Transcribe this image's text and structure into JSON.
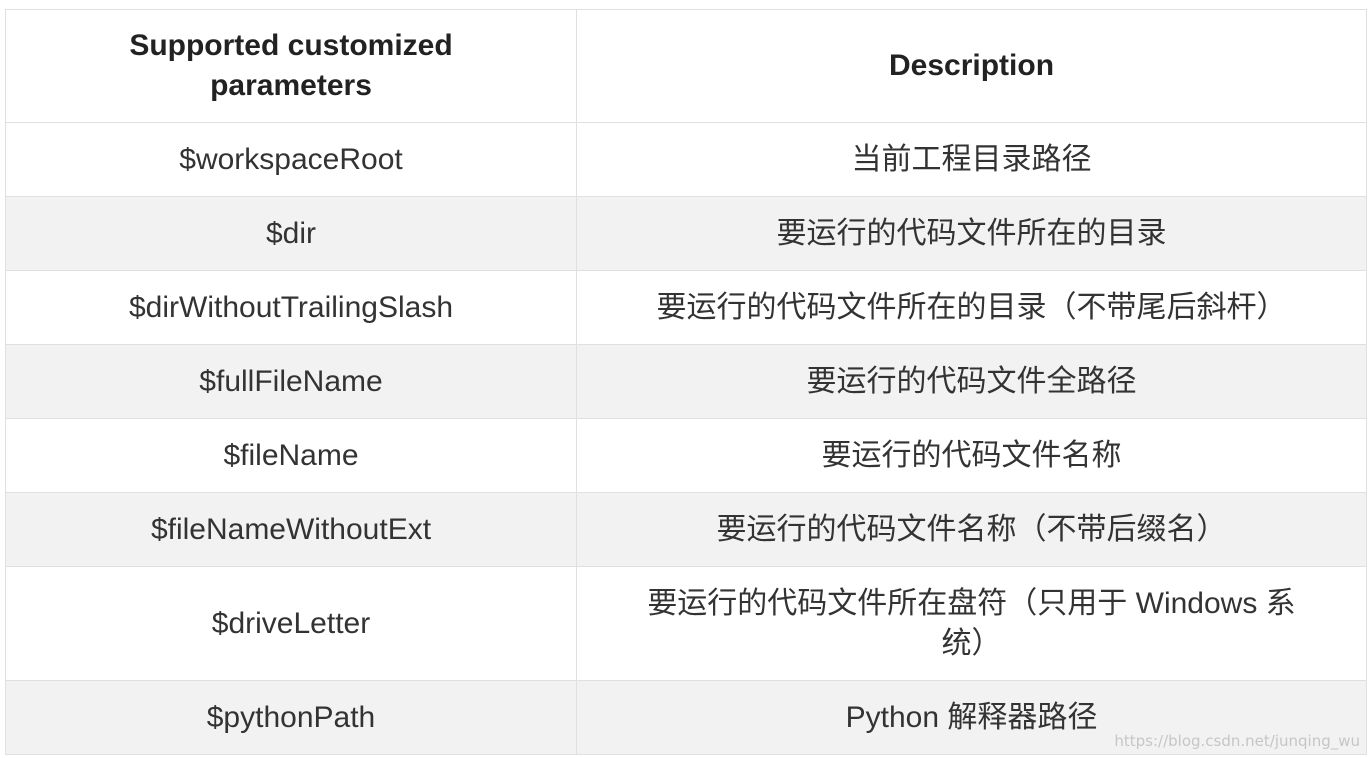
{
  "table": {
    "headers": [
      "Supported customized parameters",
      "Description"
    ],
    "rows": [
      {
        "param": "$workspaceRoot",
        "description": "当前工程目录路径"
      },
      {
        "param": "$dir",
        "description": "要运行的代码文件所在的目录"
      },
      {
        "param": "$dirWithoutTrailingSlash",
        "description": "要运行的代码文件所在的目录（不带尾后斜杆）"
      },
      {
        "param": "$fullFileName",
        "description": "要运行的代码文件全路径"
      },
      {
        "param": "$fileName",
        "description": "要运行的代码文件名称"
      },
      {
        "param": "$fileNameWithoutExt",
        "description": "要运行的代码文件名称（不带后缀名）"
      },
      {
        "param": "$driveLetter",
        "description": "要运行的代码文件所在盘符（只用于 Windows 系统）"
      },
      {
        "param": "$pythonPath",
        "description": "Python 解释器路径"
      }
    ]
  },
  "watermark": "https://blog.csdn.net/junqing_wu"
}
